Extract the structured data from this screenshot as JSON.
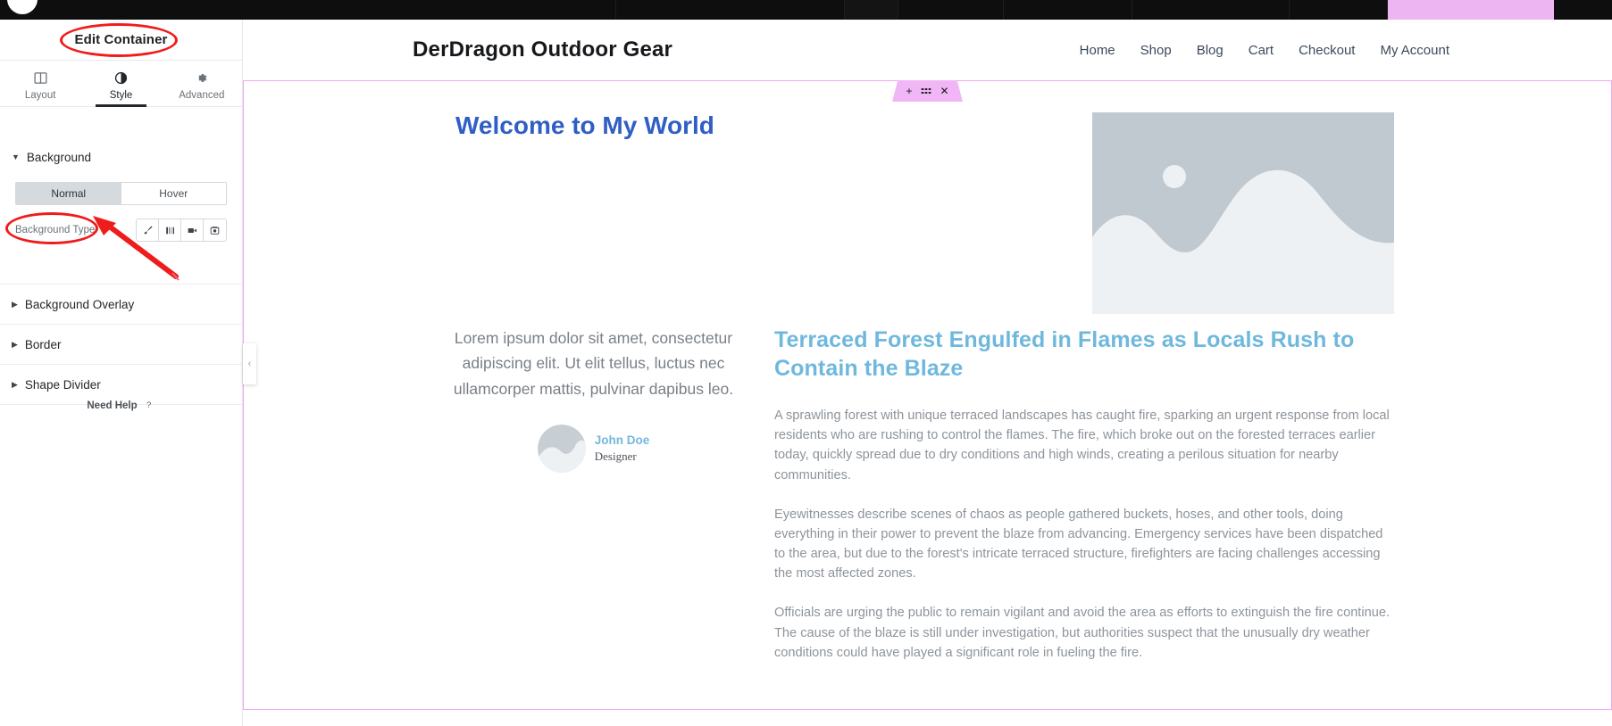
{
  "panel": {
    "title": "Edit Container",
    "tabs": [
      {
        "label": "Layout",
        "icon": "layout-icon",
        "active": false
      },
      {
        "label": "Style",
        "icon": "style-contrast-icon",
        "active": true
      },
      {
        "label": "Advanced",
        "icon": "gear-icon",
        "active": false
      }
    ],
    "background_section": {
      "label": "Background",
      "state_tabs": [
        {
          "label": "Normal",
          "active": true
        },
        {
          "label": "Hover",
          "active": false
        }
      ],
      "background_type": {
        "label": "Background Type",
        "options": [
          {
            "name": "classic",
            "icon": "paintbrush-icon"
          },
          {
            "name": "gradient",
            "icon": "gradient-bars-icon"
          },
          {
            "name": "video",
            "icon": "video-camera-icon"
          },
          {
            "name": "slideshow",
            "icon": "slideshow-image-icon"
          }
        ]
      }
    },
    "sections": [
      {
        "label": "Background Overlay"
      },
      {
        "label": "Border"
      },
      {
        "label": "Shape Divider"
      }
    ],
    "need_help": {
      "label": "Need Help",
      "icon": "question-circle-icon"
    }
  },
  "canvas": {
    "collapse_handle": "‹",
    "section_handle": {
      "add": "+",
      "drag": "drag-dots",
      "close": "✕"
    },
    "site": {
      "brand": "DerDragon Outdoor Gear",
      "nav": [
        {
          "label": "Home"
        },
        {
          "label": "Shop"
        },
        {
          "label": "Blog"
        },
        {
          "label": "Cart"
        },
        {
          "label": "Checkout"
        },
        {
          "label": "My Account"
        }
      ]
    },
    "welcome_heading": "Welcome to My World",
    "testimonial": {
      "quote": "Lorem ipsum dolor sit amet, consectetur adipiscing elit. Ut elit tellus, luctus nec ullamcorper mattis, pulvinar dapibus leo.",
      "name": "John Doe",
      "role": "Designer",
      "avatar": "avatar-placeholder"
    },
    "article": {
      "heading": "Terraced Forest Engulfed in Flames as Locals Rush to Contain the Blaze",
      "paragraphs": [
        "A sprawling forest with unique terraced landscapes has caught fire, sparking an urgent response from local residents who are rushing to control the flames. The fire, which broke out on the forested terraces earlier today, quickly spread due to dry conditions and high winds, creating a perilous situation for nearby communities.",
        "Eyewitnesses describe scenes of chaos as people gathered buckets, hoses, and other tools, doing everything in their power to prevent the blaze from advancing. Emergency services have been dispatched to the area, but due to the forest's intricate terraced structure, firefighters are facing challenges accessing the most affected zones.",
        "Officials are urging the public to remain vigilant and avoid the area as efforts to extinguish the fire continue. The cause of the blaze is still under investigation, but authorities suspect that the unusually dry weather conditions could have played a significant role in fueling the fire."
      ]
    }
  },
  "colors": {
    "annotation_red": "#ef1c1c",
    "container_outline_pink": "#f0a8f0",
    "handle_pink": "#f0b6f5",
    "welcome_blue": "#2f5ec4",
    "article_blue": "#6fb8dd",
    "name_blue": "#74b7dc"
  }
}
